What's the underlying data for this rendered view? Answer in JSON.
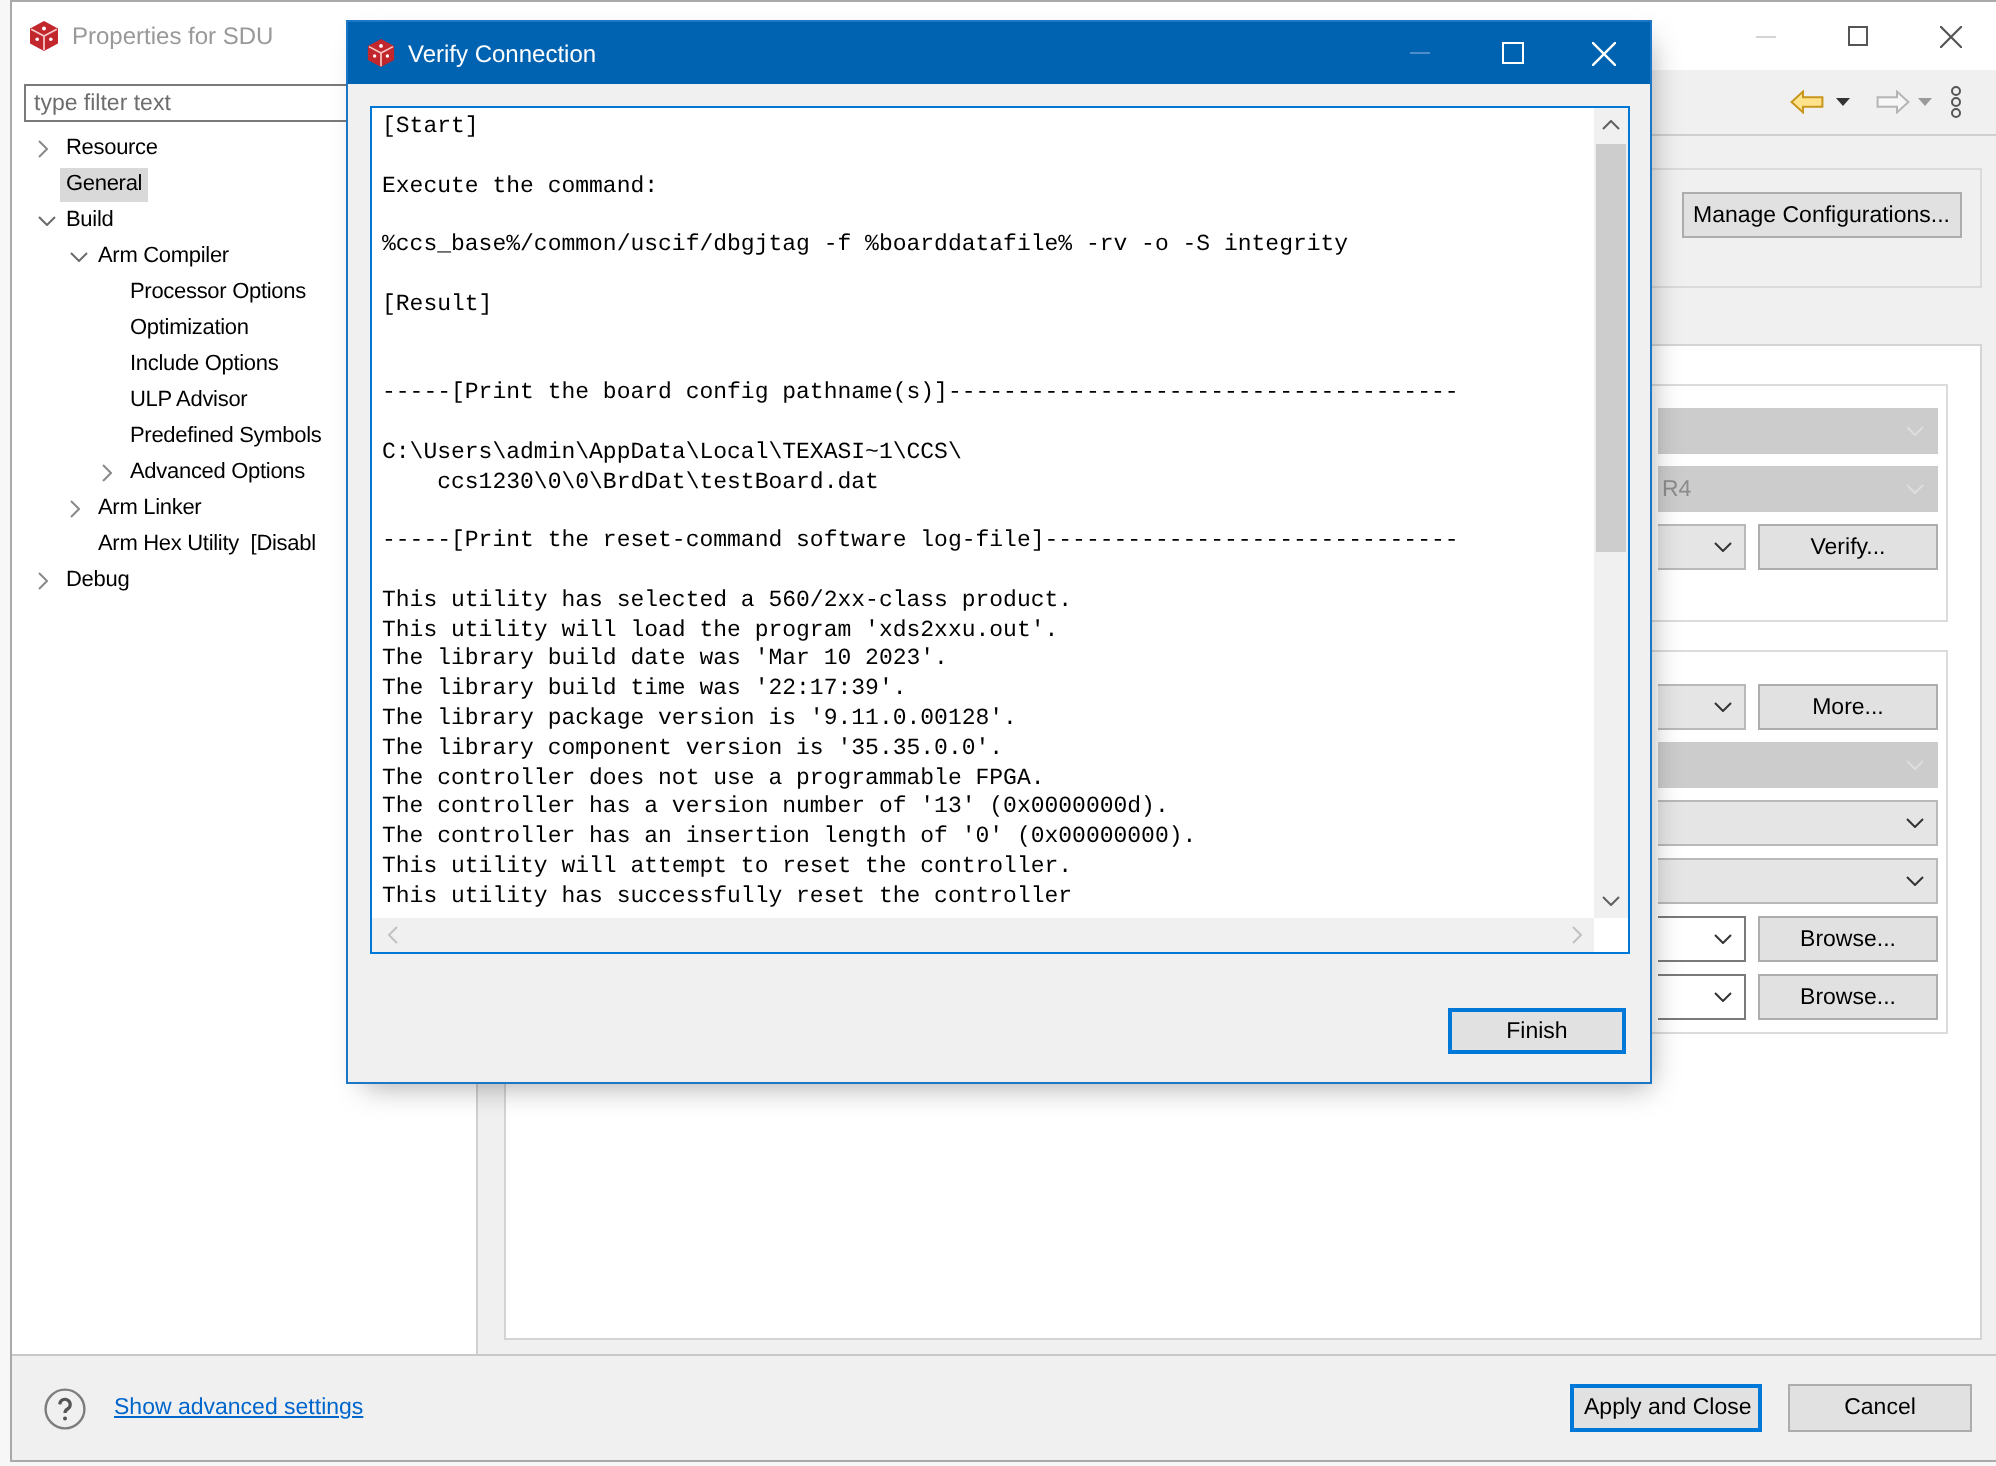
{
  "properties_window": {
    "title": "Properties for SDU",
    "active": false,
    "window_controls": [
      {
        "kind": "minimize",
        "disabled": true
      },
      {
        "kind": "maximize",
        "disabled": false
      },
      {
        "kind": "close",
        "disabled": false
      }
    ],
    "filter": {
      "placeholder": "type filter text"
    },
    "tree": [
      {
        "label": "Resource",
        "selected": false,
        "expanded": false
      },
      {
        "label": "General",
        "selected": true
      },
      {
        "label": "Build",
        "selected": false,
        "expanded": true,
        "children": [
          {
            "label": "Arm Compiler",
            "selected": false,
            "expanded": true,
            "children": [
              {
                "label": "Processor Options",
                "selected": false
              },
              {
                "label": "Optimization",
                "selected": false
              },
              {
                "label": "Include Options",
                "selected": false
              },
              {
                "label": "ULP Advisor",
                "selected": false
              },
              {
                "label": "Predefined Symbols",
                "selected": false
              },
              {
                "label": "Advanced Options",
                "selected": false,
                "expanded": false
              }
            ]
          },
          {
            "label": "Arm Linker",
            "selected": false,
            "expanded": false
          },
          {
            "label": "Arm Hex Utility  [Disabl",
            "selected": false
          }
        ]
      },
      {
        "label": "Debug",
        "selected": false,
        "expanded": false
      }
    ],
    "toolbar": [
      {
        "kind": "back",
        "disabled": false
      },
      {
        "kind": "forward",
        "disabled": true
      },
      {
        "kind": "view_menu"
      }
    ],
    "configuration_group": {
      "button": "Manage Configurations..."
    },
    "settings_groups": [
      {
        "rows": [
          {
            "kind": "combo",
            "disabled": true
          },
          {
            "kind": "combo",
            "disabled": true,
            "value": "R4"
          },
          {
            "kind": "combo",
            "disabled": false,
            "button": "Verify..."
          }
        ]
      },
      {
        "rows": [
          {
            "kind": "combo",
            "disabled": false,
            "button": "More..."
          },
          {
            "kind": "combo",
            "disabled": true
          },
          {
            "kind": "combo",
            "disabled": false
          },
          {
            "kind": "combo",
            "disabled": false
          },
          {
            "kind": "editable_combo",
            "disabled": false,
            "button": "Browse..."
          },
          {
            "kind": "editable_combo",
            "disabled": false,
            "button": "Browse..."
          }
        ]
      }
    ],
    "footer": {
      "link": "Show advanced settings",
      "buttons": [
        {
          "label": "Apply and Close",
          "default": true
        },
        {
          "label": "Cancel",
          "default": false
        }
      ]
    }
  },
  "dialog": {
    "title": "Verify Connection",
    "active": true,
    "window_controls": [
      {
        "kind": "minimize",
        "disabled": true
      },
      {
        "kind": "maximize",
        "disabled": false
      },
      {
        "kind": "close",
        "disabled": false
      }
    ],
    "log": "[Start]\n\nExecute the command:\n\n%ccs_base%/common/uscif/dbgjtag -f %boarddatafile% -rv -o -S integrity\n\n[Result]\n\n\n-----[Print the board config pathname(s)]-------------------------------------\n\nC:\\Users\\admin\\AppData\\Local\\TEXASI~1\\CCS\\\n    ccs1230\\0\\0\\BrdDat\\testBoard.dat\n\n-----[Print the reset-command software log-file]------------------------------\n\nThis utility has selected a 560/2xx-class product.\nThis utility will load the program 'xds2xxu.out'.\nThe library build date was 'Mar 10 2023'.\nThe library build time was '22:17:39'.\nThe library package version is '9.11.0.00128'.\nThe library component version is '35.35.0.0'.\nThe controller does not use a programmable FPGA.\nThe controller has a version number of '13' (0x0000000d).\nThe controller has an insertion length of '0' (0x00000000).\nThis utility will attempt to reset the controller.\nThis utility has successfully reset the controller",
    "buttons": [
      {
        "label": "Finish",
        "default": true
      }
    ]
  }
}
